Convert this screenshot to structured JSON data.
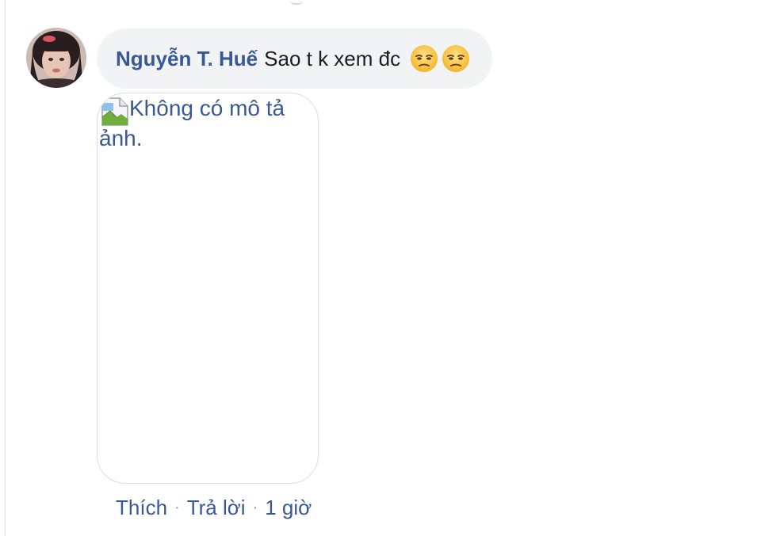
{
  "comment": {
    "author": "Nguyễn T. Huế",
    "text": "Sao t k xem đc",
    "emojis": [
      "unamused-face-icon",
      "unamused-face-icon"
    ],
    "attachment": {
      "alt_text": "Không có mô tả ảnh."
    },
    "actions": {
      "like": "Thích",
      "reply": "Trả lời",
      "separator": "·",
      "timestamp": "1 giờ"
    }
  },
  "colors": {
    "link": "#385898",
    "bubble": "#f2f3f5",
    "text": "#1c1e21",
    "meta": "#90949c"
  }
}
